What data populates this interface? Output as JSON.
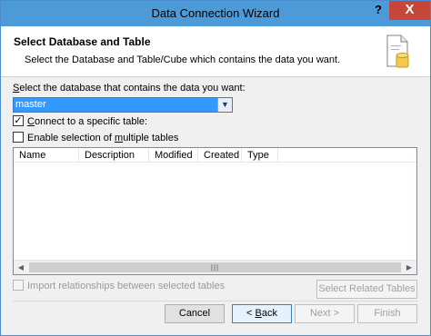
{
  "window": {
    "title": "Data Connection Wizard",
    "help_label": "?",
    "close_label": "X"
  },
  "header": {
    "title": "Select Database and Table",
    "description": "Select the Database and Table/Cube which contains the data you want.",
    "icon": "database-document-icon"
  },
  "database": {
    "label_prefix": "S",
    "label_rest": "elect the database that contains the data you want:",
    "selected": "master"
  },
  "options": {
    "connect_specific": {
      "prefix": "",
      "accel": "C",
      "rest": "onnect to a specific table:",
      "checked": true
    },
    "multiple_tables": {
      "prefix": "Enable selection of ",
      "accel": "m",
      "rest": "ultiple tables",
      "checked": false
    }
  },
  "table": {
    "columns": [
      "Name",
      "Description",
      "Modified",
      "Created",
      "Type"
    ],
    "rows": []
  },
  "import_relationships": {
    "label": "Import relationships between selected tables",
    "checked": false,
    "enabled": false
  },
  "buttons": {
    "select_related": "Select Related Tables",
    "cancel": "Cancel",
    "back_prefix": "< ",
    "back_accel": "B",
    "back_rest": "ack",
    "next": "Next >",
    "finish": "Finish"
  },
  "colors": {
    "titlebar": "#4d9ad8",
    "close": "#c7463a",
    "selection": "#3399ff"
  }
}
